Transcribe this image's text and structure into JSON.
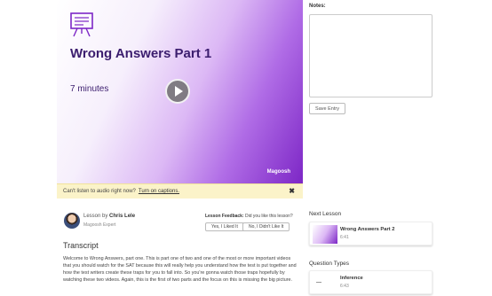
{
  "video": {
    "title": "Wrong Answers Part 1",
    "duration": "7 minutes",
    "brand_name": "Magoosh",
    "slide_icon": "presentation-board-icon",
    "play_icon": "play-icon",
    "colors": {
      "accent": "#7d27c6",
      "title": "#3b1d6e"
    }
  },
  "captions": {
    "message": "Can't listen to audio right now?",
    "link": "Turn on captions.",
    "close": "✖"
  },
  "instructor": {
    "prefix": "Lesson by",
    "name": "Chris Lele",
    "role": "Magoosh Expert"
  },
  "feedback": {
    "title": "Lesson Feedback:",
    "question": "Did you like this lesson?",
    "yes_label": "Yes, I Liked It",
    "no_label": "No, I Didn't Like It"
  },
  "transcript": {
    "heading": "Transcript",
    "text": "Welcome to Wrong Answers, part one. This is part one of two and one of the most or more important videos that you should watch for the SAT because this will really help you understand how the test is put together and how the test writers create these traps for you to fall into. So you're gonna watch those traps hopefully by watching these two videos. Again, this is the first of two parts and the focus on this is missing the big picture."
  },
  "notes": {
    "label": "Notes:",
    "value": "",
    "save_label": "Save Entry"
  },
  "next_lesson": {
    "heading": "Next Lesson",
    "title": "Wrong Answers Part 2",
    "duration": "6:41"
  },
  "question_types": {
    "heading": "Question Types",
    "title": "Inference",
    "duration": "6:43"
  }
}
